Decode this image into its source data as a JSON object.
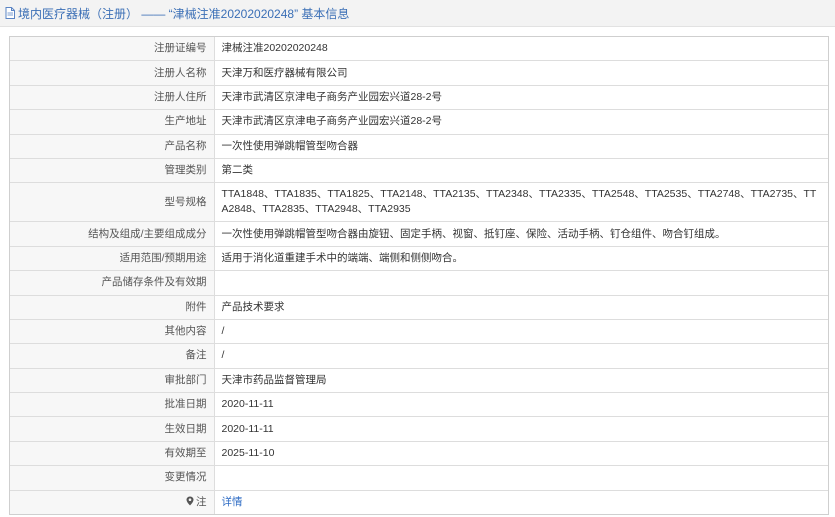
{
  "header": {
    "title": "境内医疗器械（注册） —— “津械注准20202020248” 基本信息"
  },
  "rows": [
    {
      "label": "注册证编号",
      "value": "津械注准20202020248"
    },
    {
      "label": "注册人名称",
      "value": "天津万和医疗器械有限公司"
    },
    {
      "label": "注册人住所",
      "value": "天津市武清区京津电子商务产业园宏兴道28-2号"
    },
    {
      "label": "生产地址",
      "value": "天津市武清区京津电子商务产业园宏兴道28-2号"
    },
    {
      "label": "产品名称",
      "value": "一次性使用弹跳帽管型吻合器"
    },
    {
      "label": "管理类别",
      "value": "第二类"
    },
    {
      "label": "型号规格",
      "value": "TTA1848、TTA1835、TTA1825、TTA2148、TTA2135、TTA2348、TTA2335、TTA2548、TTA2535、TTA2748、TTA2735、TTA2848、TTA2835、TTA2948、TTA2935"
    },
    {
      "label": "结构及组成/主要组成成分",
      "value": "一次性使用弹跳帽管型吻合器由旋钮、固定手柄、视窗、抵钉座、保险、活动手柄、钉仓组件、吻合钉组成。"
    },
    {
      "label": "适用范围/预期用途",
      "value": "适用于消化道重建手术中的端端、端侧和侧侧吻合。"
    },
    {
      "label": "产品储存条件及有效期",
      "value": ""
    },
    {
      "label": "附件",
      "value": "产品技术要求"
    },
    {
      "label": "其他内容",
      "value": "/"
    },
    {
      "label": "备注",
      "value": "/"
    },
    {
      "label": "审批部门",
      "value": "天津市药品监督管理局"
    },
    {
      "label": "批准日期",
      "value": "2020-11-11"
    },
    {
      "label": "生效日期",
      "value": "2020-11-11"
    },
    {
      "label": "有效期至",
      "value": "2025-11-10"
    },
    {
      "label": "变更情况",
      "value": ""
    },
    {
      "label": "注",
      "value": "详情"
    }
  ],
  "colors": {
    "header_link": "#3b6fb6",
    "detail_link": "#2f6cc4",
    "label_bg": "#f7f7f7",
    "border": "#dddddd"
  }
}
